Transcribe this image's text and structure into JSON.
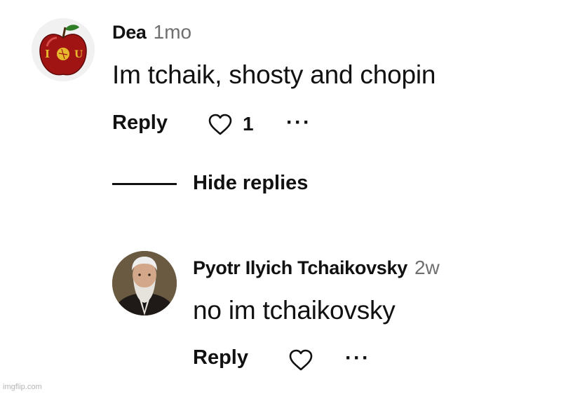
{
  "comment": {
    "author": "Dea",
    "age": "1mo",
    "text": "Im tchaik, shosty and chopin",
    "reply_label": "Reply",
    "like_count": "1",
    "more_label": "···",
    "avatar_icon": "apple-icon"
  },
  "replies_toggle": {
    "label": "Hide replies"
  },
  "reply": {
    "author": "Pyotr Ilyich Tchaikovsky",
    "age": "2w",
    "text": "no im tchaikovsky",
    "reply_label": "Reply",
    "more_label": "···",
    "avatar_icon": "portrait-icon"
  },
  "watermark": "imgflip.com",
  "colors": {
    "text": "#111111",
    "muted": "#6f6f6f",
    "background": "#ffffff"
  }
}
